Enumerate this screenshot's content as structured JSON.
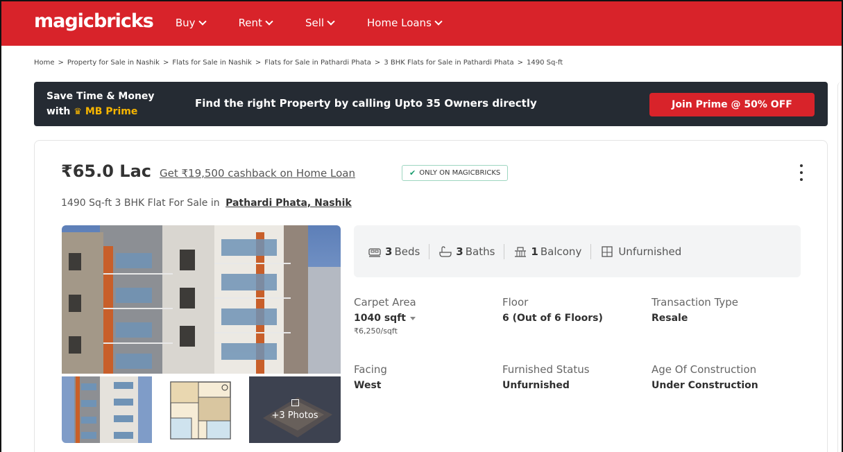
{
  "header": {
    "logo": "magicbricks",
    "nav": [
      {
        "label": "Buy"
      },
      {
        "label": "Rent"
      },
      {
        "label": "Sell"
      },
      {
        "label": "Home Loans"
      }
    ]
  },
  "breadcrumb": [
    "Home",
    "Property for Sale in Nashik",
    "Flats for Sale in Nashik",
    "Flats for Sale in Pathardi Phata",
    "3 BHK Flats for Sale in Pathardi Phata",
    "1490 Sq-ft"
  ],
  "breadcrumb_sep": ">",
  "prime": {
    "line1": "Save Time & Money",
    "line2_prefix": "with",
    "line2_brand": "MB Prime",
    "message": "Find the right Property by calling Upto 35 Owners directly",
    "cta": "Join Prime @ 50% OFF"
  },
  "listing": {
    "price": "₹65.0 Lac",
    "cashback": "Get ₹19,500 cashback on Home Loan",
    "badge": "ONLY ON MAGICBRICKS",
    "title_prefix": "1490 Sq-ft 3 BHK Flat For Sale in",
    "location": "Pathardi Phata, Nashik",
    "more_photos": "+3 Photos",
    "features": [
      {
        "icon": "bed-icon",
        "count": "3",
        "label": "Beds"
      },
      {
        "icon": "bath-icon",
        "count": "3",
        "label": "Baths"
      },
      {
        "icon": "balcony-icon",
        "count": "1",
        "label": "Balcony"
      },
      {
        "icon": "furnish-icon",
        "count": "",
        "label": "Unfurnished"
      }
    ],
    "summary": {
      "carpet_label": "Carpet Area",
      "carpet_value": "1040 sqft",
      "carpet_rate": "₹6,250/sqft",
      "floor_label": "Floor",
      "floor_value": "6 (Out of 6 Floors)",
      "transaction_label": "Transaction Type",
      "transaction_value": "Resale",
      "facing_label": "Facing",
      "facing_value": "West",
      "furnished_label": "Furnished Status",
      "furnished_value": "Unfurnished",
      "age_label": "Age Of Construction",
      "age_value": "Under Construction"
    }
  },
  "colors": {
    "brand_red": "#d8232a",
    "prime_bg": "#252b33",
    "prime_gold": "#f7b500",
    "badge_green": "#159a6b"
  }
}
